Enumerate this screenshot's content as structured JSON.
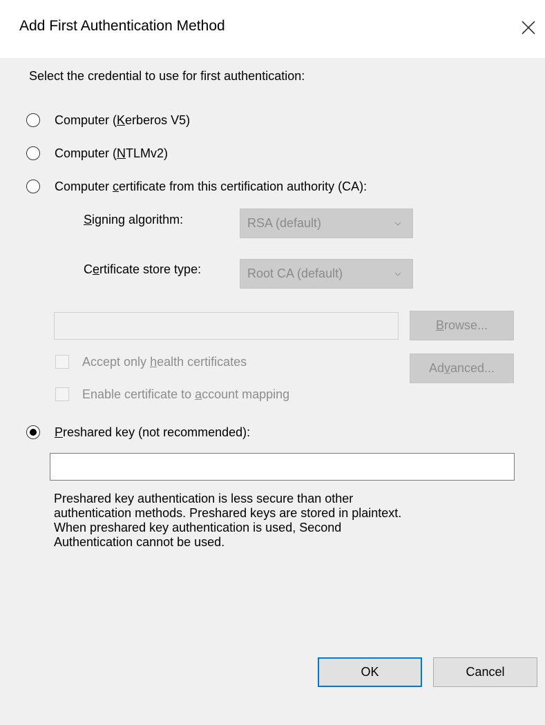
{
  "dialog": {
    "title": "Add First Authentication Method"
  },
  "instruction": "Select the credential to use for first authentication:",
  "options": {
    "kerberos": {
      "pre": "Computer (",
      "key": "K",
      "post": "erberos V5)",
      "checked": false
    },
    "ntlm": {
      "pre": "Computer (",
      "key": "N",
      "post": "TLMv2)",
      "checked": false
    },
    "certificate": {
      "pre": "Computer ",
      "key": "c",
      "post": "ertificate from this certification authority (CA):",
      "checked": false
    },
    "preshared": {
      "pre": "",
      "key": "P",
      "post": "reshared key (not recommended):",
      "checked": true
    }
  },
  "signing": {
    "label_pre": "",
    "label_key": "S",
    "label_post": "igning algorithm:",
    "value": "RSA (default)"
  },
  "store": {
    "label_pre": "C",
    "label_key": "e",
    "label_post": "rtificate store type:",
    "value": "Root CA (default)"
  },
  "ca_field": {
    "value": ""
  },
  "browse_button": {
    "pre": "",
    "key": "B",
    "post": "rowse..."
  },
  "advanced_button": {
    "pre": "Ad",
    "key": "v",
    "post": "anced..."
  },
  "health_checkbox": {
    "pre": "Accept only ",
    "key": "h",
    "post": "ealth certificates",
    "checked": false
  },
  "mapping_checkbox": {
    "pre": "Enable certificate to ",
    "key": "a",
    "post": "ccount mapping",
    "checked": false
  },
  "preshared_field": {
    "value": ""
  },
  "description": [
    "Preshared key authentication is less secure than other",
    "authentication methods. Preshared keys are stored in plaintext.",
    "When preshared key authentication is used, Second",
    "Authentication cannot be used."
  ],
  "ok_button": "OK",
  "cancel_button": "Cancel"
}
